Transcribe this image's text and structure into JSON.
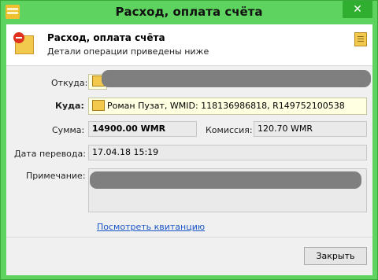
{
  "window": {
    "title": "Расход, оплата счёта",
    "close_label": "✕"
  },
  "header": {
    "title": "Расход, оплата счёта",
    "subtitle": "Детали операции приведены ниже"
  },
  "form": {
    "from_label": "Откуда:",
    "to_label": "Куда:",
    "to_value": "Роман Пузат, WMID: 118136986818, R149752100538",
    "amount_label": "Сумма:",
    "amount_value": "14900.00 WMR",
    "fee_label": "Комиссия:",
    "fee_value": "120.70 WMR",
    "date_label": "Дата перевода:",
    "date_value": "17.04.18 15:19",
    "note_label": "Примечание:"
  },
  "link_receipt": "Посмотреть квитанцию",
  "close_button": "Закрыть",
  "colors": {
    "titlebar": "#5fd35f",
    "accent_yellow": "#ffffe1",
    "link": "#1a55c8"
  }
}
